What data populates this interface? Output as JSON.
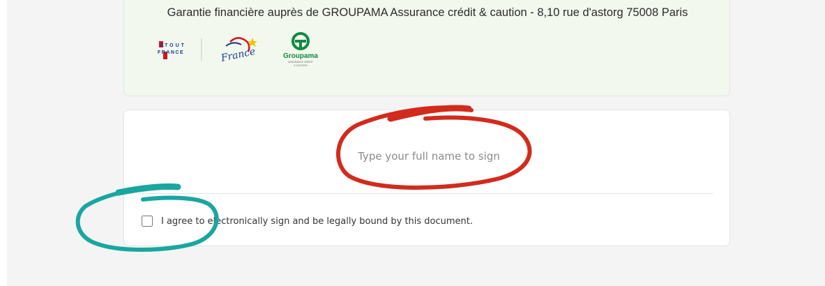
{
  "info_card": {
    "guarantee_text": "Garantie financière auprès de GROUPAMA Assurance crédit & caution - 8,10 rue d'astorg 75008 Paris",
    "logos": {
      "atout_france": {
        "top": "TOUT",
        "bottom": "FRANCE",
        "prefix": "A"
      },
      "france": {
        "text": "France"
      },
      "groupama": {
        "name": "Groupama",
        "sub1": "ASSURANCE CRÉDIT",
        "sub2": "& CAUTION"
      }
    }
  },
  "signature": {
    "placeholder": "Type your full name to sign",
    "value": ""
  },
  "consent": {
    "label": "I agree to electronically sign and be legally bound by this document.",
    "checked": false
  },
  "colors": {
    "annotation_red": "#d22b1d",
    "annotation_teal": "#1aa6a0",
    "info_card_bg": "#f2f8ee",
    "page_bg": "#f4f4f4",
    "groupama_green": "#0f8a3f",
    "atout_red": "#d4151f"
  }
}
